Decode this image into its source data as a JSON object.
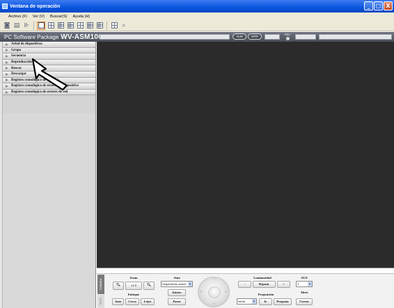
{
  "window": {
    "title": "Ventana de operación",
    "buttons": [
      "_",
      "□",
      "X"
    ]
  },
  "menu": [
    "Archivo (F)",
    "Ver (V)",
    "Buscar(S)",
    "Ayuda (H)"
  ],
  "header": {
    "package_prefix": "PC Software Package",
    "package_model": "WV-ASM100",
    "alarm_label": "ALM",
    "error_label": "ERR",
    "rec_label": "REC"
  },
  "sidebar": {
    "items": [
      "Árbol de dispositivos",
      "Grupo",
      "Secuencia",
      "Reproducción",
      "Buscar",
      "Descargar",
      "Registro cronológico de alarmas",
      "Registro cronológico de errores de dispositivo",
      "Registro cronológico de errores de red"
    ]
  },
  "panel": {
    "tabs": [
      "Cámara",
      "HDD"
    ],
    "zoom": {
      "label": "Zoom",
      "value": "x1.0"
    },
    "focus": {
      "label": "Enfoque",
      "auto": "Auto",
      "near": "Cerca",
      "far": "Lejos"
    },
    "auto": {
      "label": "Auto",
      "mode": "Seguimiento autom",
      "start": "Iniciar",
      "stop": "Parar"
    },
    "brightness": {
      "label": "Luminosidad",
      "minus": "-",
      "reset": "Reposic",
      "plus": "+"
    },
    "preset": {
      "label": "Preposición",
      "value": "Inicial",
      "go": "Ir",
      "program": "Program"
    },
    "aux": {
      "label": "AUX",
      "value": "1",
      "open": "Abrir",
      "close": "Cerrar"
    }
  },
  "icons": {
    "zoom_out": "magnifier-minus-icon",
    "zoom_in": "magnifier-plus-icon",
    "dropdown": "chevron-down-icon"
  },
  "colors": {
    "titlebar": "#0a55e0",
    "viewer": "#2b2b2b",
    "header": "#4a4f58"
  }
}
